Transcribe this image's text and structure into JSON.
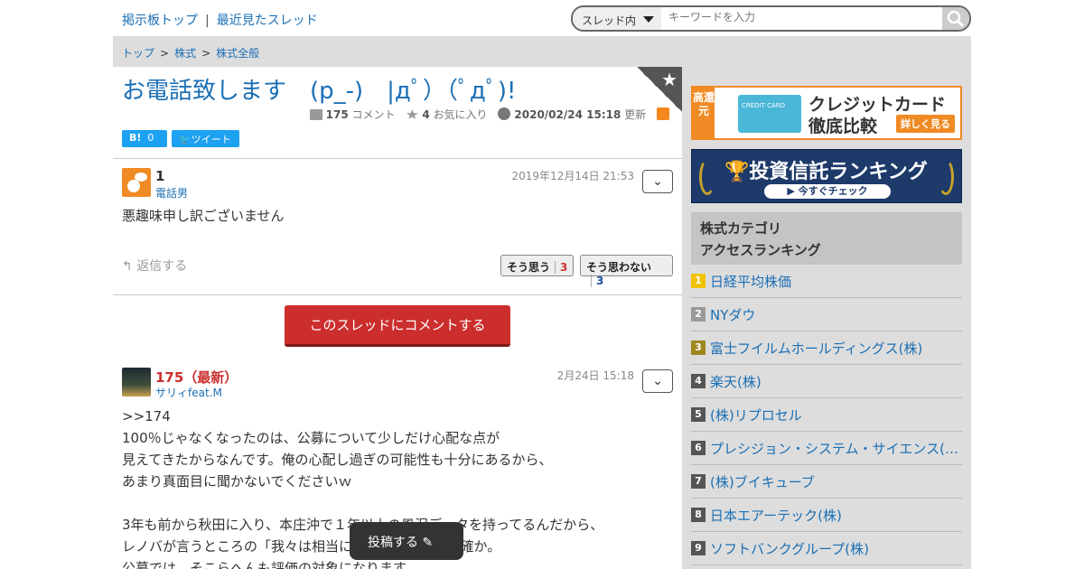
{
  "topnav": {
    "home": "掲示板トップ",
    "sep": "|",
    "recent": "最近見たスレッド"
  },
  "search": {
    "scope": "スレッド内",
    "placeholder": "キーワードを入力"
  },
  "breadcrumb": [
    "トップ",
    "株式",
    "株式全般"
  ],
  "breadcrumb_sep": ">",
  "thread": {
    "title": "お電話致します　(p_-)　|дﾟ）（ﾟдﾟ)!",
    "comments": "175",
    "comments_unit": "コメント",
    "favorites": "4",
    "favorites_unit": "お気に入り",
    "updated": "2020/02/24 15:18",
    "updated_unit": "更新",
    "hatena_label": "B!",
    "hatena_count": "0",
    "tweet_label": "ツイート"
  },
  "posts": [
    {
      "num": "1",
      "name": "電話男",
      "date": "2019年12月14日 21:53",
      "body": "悪趣味申し訳ございません",
      "reply": "返信する",
      "agree_label": "そう思う",
      "agree": "3",
      "disagree_label": "そう思わない",
      "disagree": "3"
    },
    {
      "num": "175（最新）",
      "name": "サリィfeat.M",
      "date": "2月24日 15:18",
      "body": ">>174\n100％じゃなくなったのは、公募について少しだけ心配な点が\n見えてきたからなんです。俺の心配し過ぎの可能性も十分にあるから、\nあまり真面目に聞かないでくださいｗ\n\n3年も前から秋田に入り、本庄沖で１年以上の風況データを持ってるんだから、\nレノバが言うところの「我々は相当に先行している」は確か。\n公募では、そこらへんも評価の対象になります。"
    }
  ],
  "cta": "このスレッドにコメントする",
  "fab": "投稿する",
  "banners": {
    "card_side": "高還元",
    "card_title1": "クレジットカード",
    "card_title2": "徹底比較",
    "card_btn": "詳しく見る",
    "card_img": "CREDIT CARD",
    "fund_title": "投資信託ランキング",
    "fund_btn": "今すぐチェック"
  },
  "ranking": {
    "heading1": "株式カテゴリ",
    "heading2": "アクセスランキング",
    "items": [
      "日経平均株価",
      "NYダウ",
      "富士フイルムホールディングス(株)",
      "楽天(株)",
      "(株)リプロセル",
      "プレシジョン・システム・サイエンス(株)",
      "(株)ブイキューブ",
      "日本エアーテック(株)",
      "ソフトバンクグループ(株)"
    ],
    "badge_colors": [
      "#f2c200",
      "#999999",
      "#a0861f",
      "#555555",
      "#555555",
      "#555555",
      "#555555",
      "#555555",
      "#555555"
    ]
  }
}
